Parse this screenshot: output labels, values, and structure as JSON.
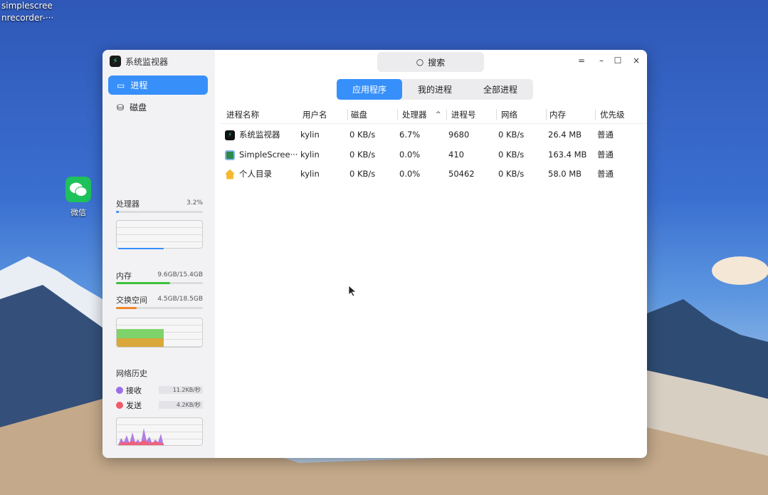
{
  "desktop": {
    "icon_label_line1": "simplescree",
    "icon_label_line2": "nrecorder-···",
    "wechat_label": "微信"
  },
  "window": {
    "title": "系统监视器",
    "search_placeholder": "搜索",
    "controls": {
      "menu": "=",
      "minimize": "–",
      "maximize": "☐",
      "close": "×"
    }
  },
  "sidebar": {
    "nav": [
      {
        "label": "进程",
        "active": true
      },
      {
        "label": "磁盘",
        "active": false
      }
    ],
    "cpu": {
      "label": "处理器",
      "value": "3.2%",
      "percent": 3.2
    },
    "memory": {
      "label": "内存",
      "value": "9.6GB/15.4GB",
      "percent": 62
    },
    "swap": {
      "label": "交换空间",
      "value": "4.5GB/18.5GB",
      "percent": 24
    },
    "network": {
      "title": "网络历史",
      "receive_label": "接收",
      "receive_value": "11.2KB/秒",
      "send_label": "发送",
      "send_value": "4.2KB/秒"
    }
  },
  "tabs": [
    {
      "label": "应用程序",
      "active": true
    },
    {
      "label": "我的进程",
      "active": false
    },
    {
      "label": "全部进程",
      "active": false
    }
  ],
  "table": {
    "headers": [
      "进程名称",
      "用户名",
      "磁盘",
      "处理器",
      "进程号",
      "网络",
      "内存",
      "优先级"
    ],
    "sort_indicator": "^",
    "rows": [
      {
        "name": "系统监视器",
        "user": "kylin",
        "disk": "0 KB/s",
        "cpu": "6.7%",
        "pid": "9680",
        "net": "0 KB/s",
        "mem": "26.4 MB",
        "priority": "普通",
        "icon": "monitor-icon"
      },
      {
        "name": "SimpleScree···",
        "user": "kylin",
        "disk": "0 KB/s",
        "cpu": "0.0%",
        "pid": "410",
        "net": "0 KB/s",
        "mem": "163.4 MB",
        "priority": "普通",
        "icon": "screenrecorder-icon"
      },
      {
        "name": "个人目录",
        "user": "kylin",
        "disk": "0 KB/s",
        "cpu": "0.0%",
        "pid": "50462",
        "net": "0 KB/s",
        "mem": "58.0 MB",
        "priority": "普通",
        "icon": "home-folder-icon"
      }
    ]
  },
  "colors": {
    "accent": "#3790fa",
    "memory": "#3cc13c",
    "swap": "#f0862a",
    "receive": "#9b6ee8",
    "send": "#f05a6a"
  }
}
